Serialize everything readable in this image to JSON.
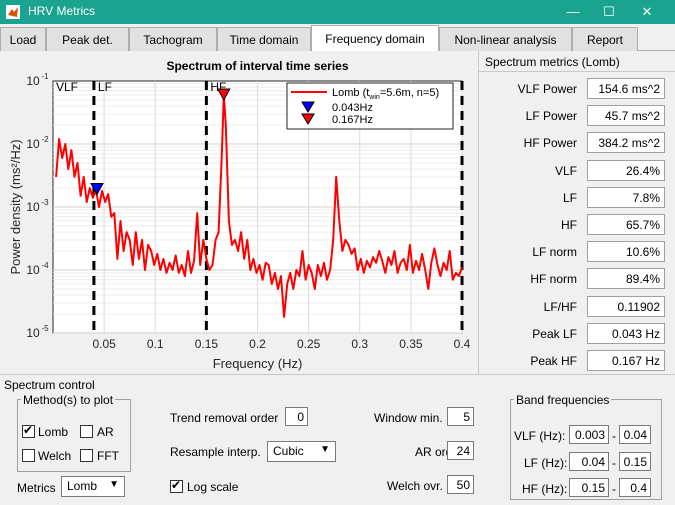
{
  "window": {
    "title": "HRV Metrics",
    "minimize": "—",
    "maximize": "☐",
    "close": "✕"
  },
  "tabs": [
    "Load",
    "Peak det.",
    "Tachogram",
    "Time domain",
    "Frequency domain",
    "Non-linear analysis",
    "Report"
  ],
  "active_tab": "Frequency domain",
  "metrics_panel": {
    "title": "Spectrum metrics (Lomb)",
    "rows": [
      {
        "label": "VLF Power",
        "value": "154.6 ms^2"
      },
      {
        "label": "LF Power",
        "value": "45.7 ms^2"
      },
      {
        "label": "HF Power",
        "value": "384.2 ms^2"
      },
      {
        "label": "VLF",
        "value": "26.4%"
      },
      {
        "label": "LF",
        "value": "7.8%"
      },
      {
        "label": "HF",
        "value": "65.7%"
      },
      {
        "label": "LF norm",
        "value": "10.6%"
      },
      {
        "label": "HF norm",
        "value": "89.4%"
      },
      {
        "label": "LF/HF",
        "value": "0.11902"
      },
      {
        "label": "Peak LF",
        "value": "0.043 Hz"
      },
      {
        "label": "Peak HF",
        "value": "0.167 Hz"
      }
    ]
  },
  "chart_data": {
    "type": "line",
    "title": "Spectrum of interval time series",
    "xlabel": "Frequency (Hz)",
    "ylabel": "Power density (ms²/Hz)",
    "yscale": "log",
    "xlim": [
      0,
      0.4
    ],
    "ylim": [
      1e-05,
      0.1
    ],
    "x_ticks": [
      "0.05",
      "0.1",
      "0.15",
      "0.2",
      "0.25",
      "0.3",
      "0.35",
      "0.4"
    ],
    "y_ticks": [
      "10",
      "10",
      "10",
      "10",
      "10"
    ],
    "y_tick_exponents": [
      "-5",
      "-4",
      "-3",
      "-2",
      "-1"
    ],
    "grid": true,
    "band_lines": [
      0.04,
      0.15,
      0.4
    ],
    "band_labels": [
      "VLF",
      "LF",
      "HF"
    ],
    "series": [
      {
        "name": "Lomb",
        "color": "#ff0000",
        "x": [
          0.003,
          0.006,
          0.009,
          0.012,
          0.015,
          0.018,
          0.021,
          0.024,
          0.027,
          0.03,
          0.033,
          0.036,
          0.039,
          0.042,
          0.045,
          0.048,
          0.051,
          0.054,
          0.057,
          0.06,
          0.063,
          0.066,
          0.069,
          0.072,
          0.075,
          0.078,
          0.081,
          0.084,
          0.087,
          0.09,
          0.093,
          0.096,
          0.099,
          0.102,
          0.105,
          0.108,
          0.111,
          0.114,
          0.117,
          0.12,
          0.123,
          0.126,
          0.129,
          0.132,
          0.135,
          0.138,
          0.141,
          0.144,
          0.147,
          0.15,
          0.153,
          0.156,
          0.159,
          0.162,
          0.165,
          0.167,
          0.169,
          0.172,
          0.175,
          0.178,
          0.181,
          0.184,
          0.187,
          0.19,
          0.193,
          0.196,
          0.199,
          0.202,
          0.205,
          0.208,
          0.211,
          0.214,
          0.217,
          0.22,
          0.223,
          0.226,
          0.229,
          0.232,
          0.235,
          0.238,
          0.241,
          0.244,
          0.247,
          0.25,
          0.253,
          0.256,
          0.259,
          0.262,
          0.265,
          0.268,
          0.271,
          0.274,
          0.277,
          0.28,
          0.283,
          0.286,
          0.289,
          0.292,
          0.295,
          0.298,
          0.301,
          0.304,
          0.307,
          0.31,
          0.313,
          0.316,
          0.319,
          0.322,
          0.325,
          0.328,
          0.331,
          0.334,
          0.337,
          0.34,
          0.343,
          0.346,
          0.349,
          0.352,
          0.355,
          0.358,
          0.361,
          0.364,
          0.367,
          0.37,
          0.373,
          0.376,
          0.379,
          0.382,
          0.385,
          0.388,
          0.391,
          0.394,
          0.397,
          0.4
        ],
        "y": [
          0.003,
          0.012,
          0.006,
          0.01,
          0.004,
          0.008,
          0.003,
          0.005,
          0.0015,
          0.003,
          0.0012,
          0.002,
          0.0014,
          0.0019,
          0.001,
          0.0018,
          0.0012,
          0.0016,
          0.0007,
          0.0008,
          0.00015,
          0.0006,
          0.0002,
          0.0004,
          0.0003,
          0.00012,
          0.0004,
          0.00015,
          0.0003,
          0.0001,
          0.00025,
          0.0002,
          0.00012,
          0.00018,
          0.0001,
          0.00015,
          9e-05,
          0.00013,
          0.0001,
          0.00017,
          9e-05,
          0.00012,
          8e-05,
          0.0002,
          9e-05,
          0.00014,
          0.0008,
          0.00012,
          0.0003,
          0.00015,
          0.0001,
          0.00012,
          0.0003,
          0.0004,
          0.006,
          0.06,
          0.02,
          0.0006,
          0.00025,
          0.0003,
          0.0002,
          0.0004,
          0.00015,
          0.0003,
          0.0001,
          0.00015,
          9e-05,
          0.00012,
          7e-05,
          0.00013,
          0.00012,
          6e-05,
          9e-05,
          5e-05,
          8e-05,
          1.8e-05,
          6e-05,
          9e-05,
          5e-05,
          0.0001,
          8e-05,
          0.0002,
          7e-05,
          0.00012,
          9e-05,
          5e-05,
          0.00012,
          8e-05,
          0.00013,
          7e-05,
          0.0001,
          0.0003,
          0.003,
          0.0006,
          0.0002,
          0.0003,
          0.00025,
          0.00018,
          0.00022,
          0.0001,
          0.00015,
          9e-05,
          0.00014,
          0.00011,
          0.00016,
          0.00013,
          0.0002,
          0.00014,
          9e-05,
          0.00016,
          0.00012,
          0.0002,
          9e-05,
          0.00013,
          0.00015,
          0.0001,
          0.00025,
          9e-05,
          0.00014,
          0.0001,
          0.00018,
          0.0001,
          5e-05,
          0.00013,
          0.00022,
          0.00012,
          8e-05,
          0.00013,
          0.0001,
          0.0002,
          7e-05,
          9e-05,
          8e-05,
          0.00011
        ]
      }
    ],
    "legend": {
      "entries": [
        {
          "text": "Lomb (t_win=5.6m, n=5)",
          "win_label": "Lomb (t",
          "win_sub": "win",
          "win_rest": "=5.6m,  n=5)"
        },
        {
          "text": "0.043Hz",
          "marker_color": "#0000ff"
        },
        {
          "text": "0.167Hz",
          "marker_color": "#ff0000"
        }
      ],
      "placement": "top-right"
    },
    "peak_markers": [
      {
        "x": 0.043,
        "y": 0.0019,
        "color": "#0000ff"
      },
      {
        "x": 0.167,
        "y": 0.06,
        "color": "#ff0000"
      }
    ]
  },
  "spectrum_control": {
    "title": "Spectrum control",
    "methods_group": {
      "title": "Method(s) to plot",
      "lomb": {
        "label": "Lomb",
        "checked": true
      },
      "ar": {
        "label": "AR",
        "checked": false
      },
      "welch": {
        "label": "Welch",
        "checked": false
      },
      "fft": {
        "label": "FFT",
        "checked": false
      }
    },
    "metrics_label": "Metrics",
    "metrics_value": "Lomb",
    "trend_label": "Trend removal order",
    "trend_value": "0",
    "resample_label": "Resample interp.",
    "resample_value": "Cubic",
    "logscale": {
      "label": "Log scale",
      "checked": true
    },
    "window_label": "Window min.",
    "window_value": "5",
    "ar_order_label": "AR order",
    "ar_order_value": "24",
    "welch_label": "Welch ovr.",
    "welch_value": "50",
    "bands_group": {
      "title": "Band frequencies",
      "vlf": {
        "label": "VLF (Hz):",
        "min": "0.003",
        "max": "0.04"
      },
      "lf": {
        "label": "LF (Hz):",
        "min": "0.04",
        "max": "0.15"
      },
      "hf": {
        "label": "HF (Hz):",
        "min": "0.15",
        "max": "0.4"
      },
      "separator": "-"
    }
  }
}
